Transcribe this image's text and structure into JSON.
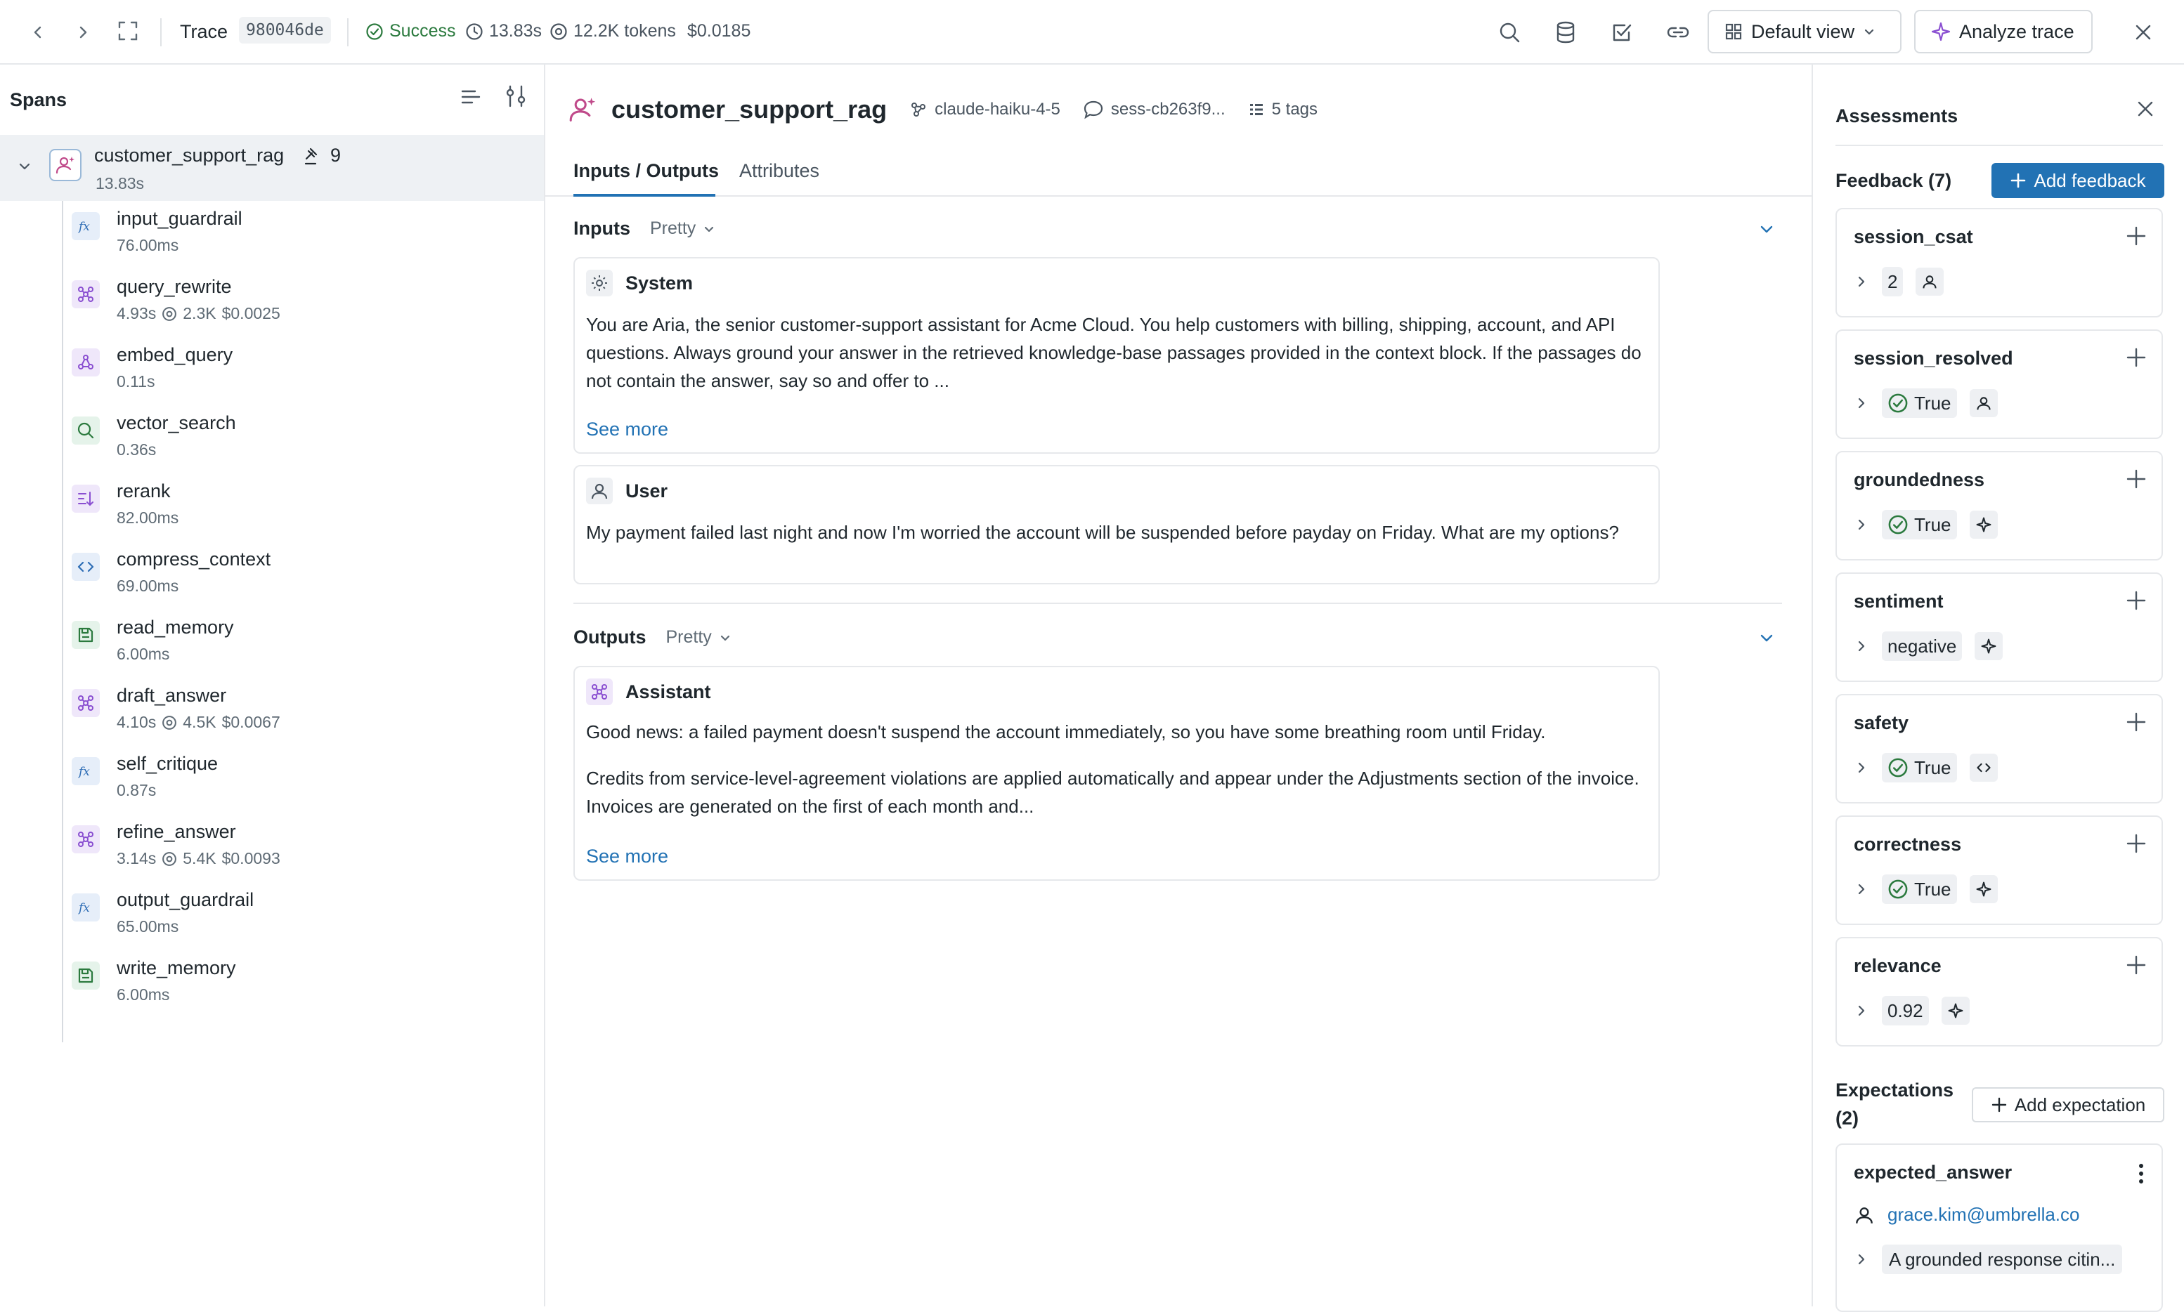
{
  "topbar": {
    "trace_label": "Trace",
    "trace_id": "980046de",
    "status": "Success",
    "duration": "13.83s",
    "tokens": "12.2K tokens",
    "cost": "$0.0185",
    "default_view_label": "Default view",
    "analyze_label": "Analyze trace"
  },
  "spans_panel": {
    "title": "Spans",
    "root": {
      "name": "customer_support_rag",
      "count": "9",
      "duration": "13.83s"
    },
    "items": [
      {
        "name": "input_guardrail",
        "duration": "76.00ms",
        "tokens": "",
        "cost": "",
        "icon": "function-icon"
      },
      {
        "name": "query_rewrite",
        "duration": "4.93s",
        "tokens": "2.3K",
        "cost": "$0.0025",
        "icon": "llm-icon"
      },
      {
        "name": "embed_query",
        "duration": "0.11s",
        "tokens": "",
        "cost": "",
        "icon": "embedding-icon"
      },
      {
        "name": "vector_search",
        "duration": "0.36s",
        "tokens": "",
        "cost": "",
        "icon": "search-icon"
      },
      {
        "name": "rerank",
        "duration": "82.00ms",
        "tokens": "",
        "cost": "",
        "icon": "rerank-icon"
      },
      {
        "name": "compress_context",
        "duration": "69.00ms",
        "tokens": "",
        "cost": "",
        "icon": "code-icon"
      },
      {
        "name": "read_memory",
        "duration": "6.00ms",
        "tokens": "",
        "cost": "",
        "icon": "memory-icon"
      },
      {
        "name": "draft_answer",
        "duration": "4.10s",
        "tokens": "4.5K",
        "cost": "$0.0067",
        "icon": "llm-icon"
      },
      {
        "name": "self_critique",
        "duration": "0.87s",
        "tokens": "",
        "cost": "",
        "icon": "function-icon"
      },
      {
        "name": "refine_answer",
        "duration": "3.14s",
        "tokens": "5.4K",
        "cost": "$0.0093",
        "icon": "llm-icon"
      },
      {
        "name": "output_guardrail",
        "duration": "65.00ms",
        "tokens": "",
        "cost": "",
        "icon": "function-icon"
      },
      {
        "name": "write_memory",
        "duration": "6.00ms",
        "tokens": "",
        "cost": "",
        "icon": "memory-icon"
      }
    ]
  },
  "detail": {
    "title": "customer_support_rag",
    "model": "claude-haiku-4-5",
    "session": "sess-cb263f9...",
    "tags": "5 tags",
    "tabs": [
      "Inputs / Outputs",
      "Attributes"
    ],
    "inputs": {
      "title": "Inputs",
      "format": "Pretty",
      "system_label": "System",
      "system_text": "You are Aria, the senior customer-support assistant for Acme Cloud. You help customers with billing, shipping, account, and API questions. Always ground your answer in the retrieved knowledge-base passages provided in the context block. If the passages do not contain the answer, say so and offer to ...",
      "see_more": "See more",
      "user_label": "User",
      "user_text": "My payment failed last night and now I'm worried the account will be suspended before payday on Friday. What are my options?"
    },
    "outputs": {
      "title": "Outputs",
      "format": "Pretty",
      "assistant_label": "Assistant",
      "para1": "Good news: a failed payment doesn't suspend the account immediately, so you have some breathing room until Friday.",
      "para2": "Credits from service-level-agreement violations are applied automatically and appear under the Adjustments section of the invoice. Invoices are generated on the first of each month and...",
      "see_more": "See more"
    }
  },
  "assessments": {
    "title": "Assessments",
    "feedback_title": "Feedback (7)",
    "add_feedback": "Add feedback",
    "feedback": [
      {
        "name": "session_csat",
        "value": "2",
        "check": false,
        "source": "user-icon"
      },
      {
        "name": "session_resolved",
        "value": "True",
        "check": true,
        "source": "user-icon"
      },
      {
        "name": "groundedness",
        "value": "True",
        "check": true,
        "source": "sparkle-icon"
      },
      {
        "name": "sentiment",
        "value": "negative",
        "check": false,
        "source": "sparkle-icon"
      },
      {
        "name": "safety",
        "value": "True",
        "check": true,
        "source": "code-icon"
      },
      {
        "name": "correctness",
        "value": "True",
        "check": true,
        "source": "sparkle-icon"
      },
      {
        "name": "relevance",
        "value": "0.92",
        "check": false,
        "source": "sparkle-icon"
      }
    ],
    "expectations_title": "Expectations (2)",
    "add_expectation": "Add expectation",
    "expectation": {
      "name": "expected_answer",
      "user": "grace.kim@umbrella.co",
      "value": "A grounded response citin..."
    }
  },
  "colors": {
    "accent": "#2272b4",
    "success": "#2b7a3e",
    "llm_purple": "#8a4fd1"
  }
}
